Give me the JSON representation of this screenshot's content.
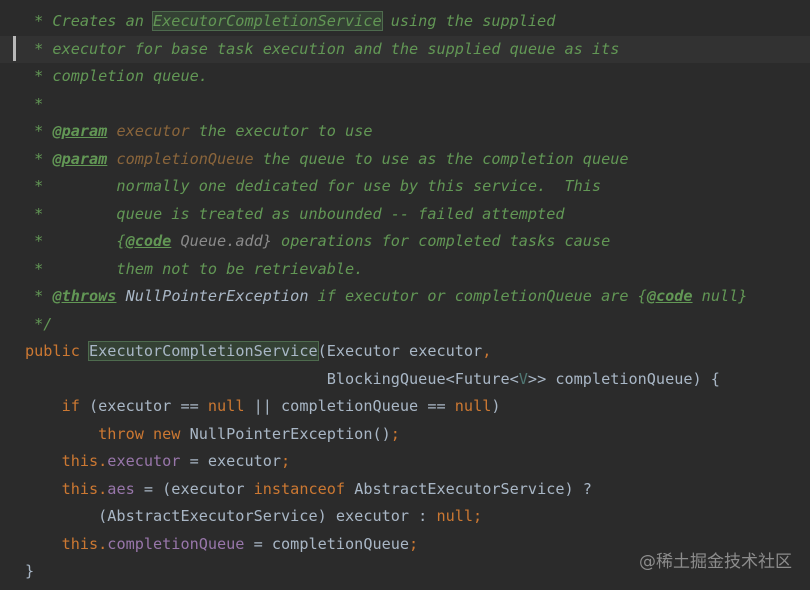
{
  "lines": [
    {
      "segments": [
        {
          "text": " * Creates an ",
          "style": "doc-text"
        },
        {
          "text": "ExecutorCompletionService",
          "style": "doc-text hl"
        },
        {
          "text": " using the supplied",
          "style": "doc-text"
        }
      ]
    },
    {
      "segments": [
        {
          "text": " * executor for base task execution and the supplied queue as its",
          "style": "doc-text"
        }
      ]
    },
    {
      "segments": [
        {
          "text": " * completion queue.",
          "style": "doc-text"
        }
      ]
    },
    {
      "segments": [
        {
          "text": " *",
          "style": "doc-text"
        }
      ]
    },
    {
      "segments": [
        {
          "text": " * ",
          "style": "doc-text"
        },
        {
          "text": "@param",
          "style": "doc-tag"
        },
        {
          "text": " executor",
          "style": "doc-param"
        },
        {
          "text": " the executor to use",
          "style": "doc-text"
        }
      ]
    },
    {
      "segments": [
        {
          "text": " * ",
          "style": "doc-text"
        },
        {
          "text": "@param",
          "style": "doc-tag"
        },
        {
          "text": " completionQueue",
          "style": "doc-param"
        },
        {
          "text": " the queue to use as the completion queue",
          "style": "doc-text"
        }
      ]
    },
    {
      "segments": [
        {
          "text": " *        normally one dedicated for use by this service.  This",
          "style": "doc-text"
        }
      ]
    },
    {
      "segments": [
        {
          "text": " *        queue is treated as unbounded -- failed attempted",
          "style": "doc-text"
        }
      ]
    },
    {
      "segments": [
        {
          "text": " *        {",
          "style": "doc-text"
        },
        {
          "text": "@code",
          "style": "doc-tag"
        },
        {
          "text": " Queue.add}",
          "style": "doc-code"
        },
        {
          "text": " operations for completed tasks cause",
          "style": "doc-text"
        }
      ]
    },
    {
      "segments": [
        {
          "text": " *        them not to be retrievable.",
          "style": "doc-text"
        }
      ]
    },
    {
      "segments": [
        {
          "text": " * ",
          "style": "doc-text"
        },
        {
          "text": "@throws",
          "style": "doc-tag"
        },
        {
          "text": " NullPointerException",
          "style": "doc-ref"
        },
        {
          "text": " if executor or completionQueue are {",
          "style": "doc-text"
        },
        {
          "text": "@code",
          "style": "doc-tag"
        },
        {
          "text": " null}",
          "style": "doc-text"
        }
      ]
    },
    {
      "segments": [
        {
          "text": " */",
          "style": "doc-text"
        }
      ]
    },
    {
      "segments": [
        {
          "text": "public ",
          "style": "kw"
        },
        {
          "text": "ExecutorCompletionService",
          "style": "plain hl"
        },
        {
          "text": "(Executor executor",
          "style": "plain"
        },
        {
          "text": ",",
          "style": "kw"
        }
      ]
    },
    {
      "segments": [
        {
          "text": "                                 BlockingQueue<Future<",
          "style": "plain"
        },
        {
          "text": "V",
          "style": "type-param"
        },
        {
          "text": ">> completionQueue) {",
          "style": "plain"
        }
      ]
    },
    {
      "segments": [
        {
          "text": "    ",
          "style": "plain"
        },
        {
          "text": "if ",
          "style": "kw"
        },
        {
          "text": "(executor == ",
          "style": "plain"
        },
        {
          "text": "null ",
          "style": "kw"
        },
        {
          "text": "|| completionQueue == ",
          "style": "plain"
        },
        {
          "text": "null",
          "style": "kw"
        },
        {
          "text": ")",
          "style": "plain"
        }
      ]
    },
    {
      "segments": [
        {
          "text": "        ",
          "style": "plain"
        },
        {
          "text": "throw new ",
          "style": "kw"
        },
        {
          "text": "NullPointerException()",
          "style": "plain"
        },
        {
          "text": ";",
          "style": "kw"
        }
      ]
    },
    {
      "segments": [
        {
          "text": "    ",
          "style": "plain"
        },
        {
          "text": "this.",
          "style": "kw"
        },
        {
          "text": "executor",
          "style": "field"
        },
        {
          "text": " = executor",
          "style": "plain"
        },
        {
          "text": ";",
          "style": "kw"
        }
      ]
    },
    {
      "segments": [
        {
          "text": "    ",
          "style": "plain"
        },
        {
          "text": "this.",
          "style": "kw"
        },
        {
          "text": "aes",
          "style": "field"
        },
        {
          "text": " = (executor ",
          "style": "plain"
        },
        {
          "text": "instanceof ",
          "style": "kw"
        },
        {
          "text": "AbstractExecutorService) ?",
          "style": "plain"
        }
      ]
    },
    {
      "segments": [
        {
          "text": "        (AbstractExecutorService) executor : ",
          "style": "plain"
        },
        {
          "text": "null;",
          "style": "kw"
        }
      ]
    },
    {
      "segments": [
        {
          "text": "    ",
          "style": "plain"
        },
        {
          "text": "this.",
          "style": "kw"
        },
        {
          "text": "completionQueue",
          "style": "field"
        },
        {
          "text": " = completionQueue",
          "style": "plain"
        },
        {
          "text": ";",
          "style": "kw"
        }
      ]
    },
    {
      "segments": [
        {
          "text": "}",
          "style": "plain"
        }
      ]
    }
  ],
  "watermark": "@稀土掘金技术社区",
  "colors": {
    "background": "#2b2b2b",
    "doc_comment": "#629755",
    "keyword": "#cc7832",
    "identifier": "#a9b7c6",
    "field": "#9876aa",
    "type_parameter": "#507874",
    "doc_param_name": "#8a653b",
    "highlight_bg": "#344134"
  }
}
